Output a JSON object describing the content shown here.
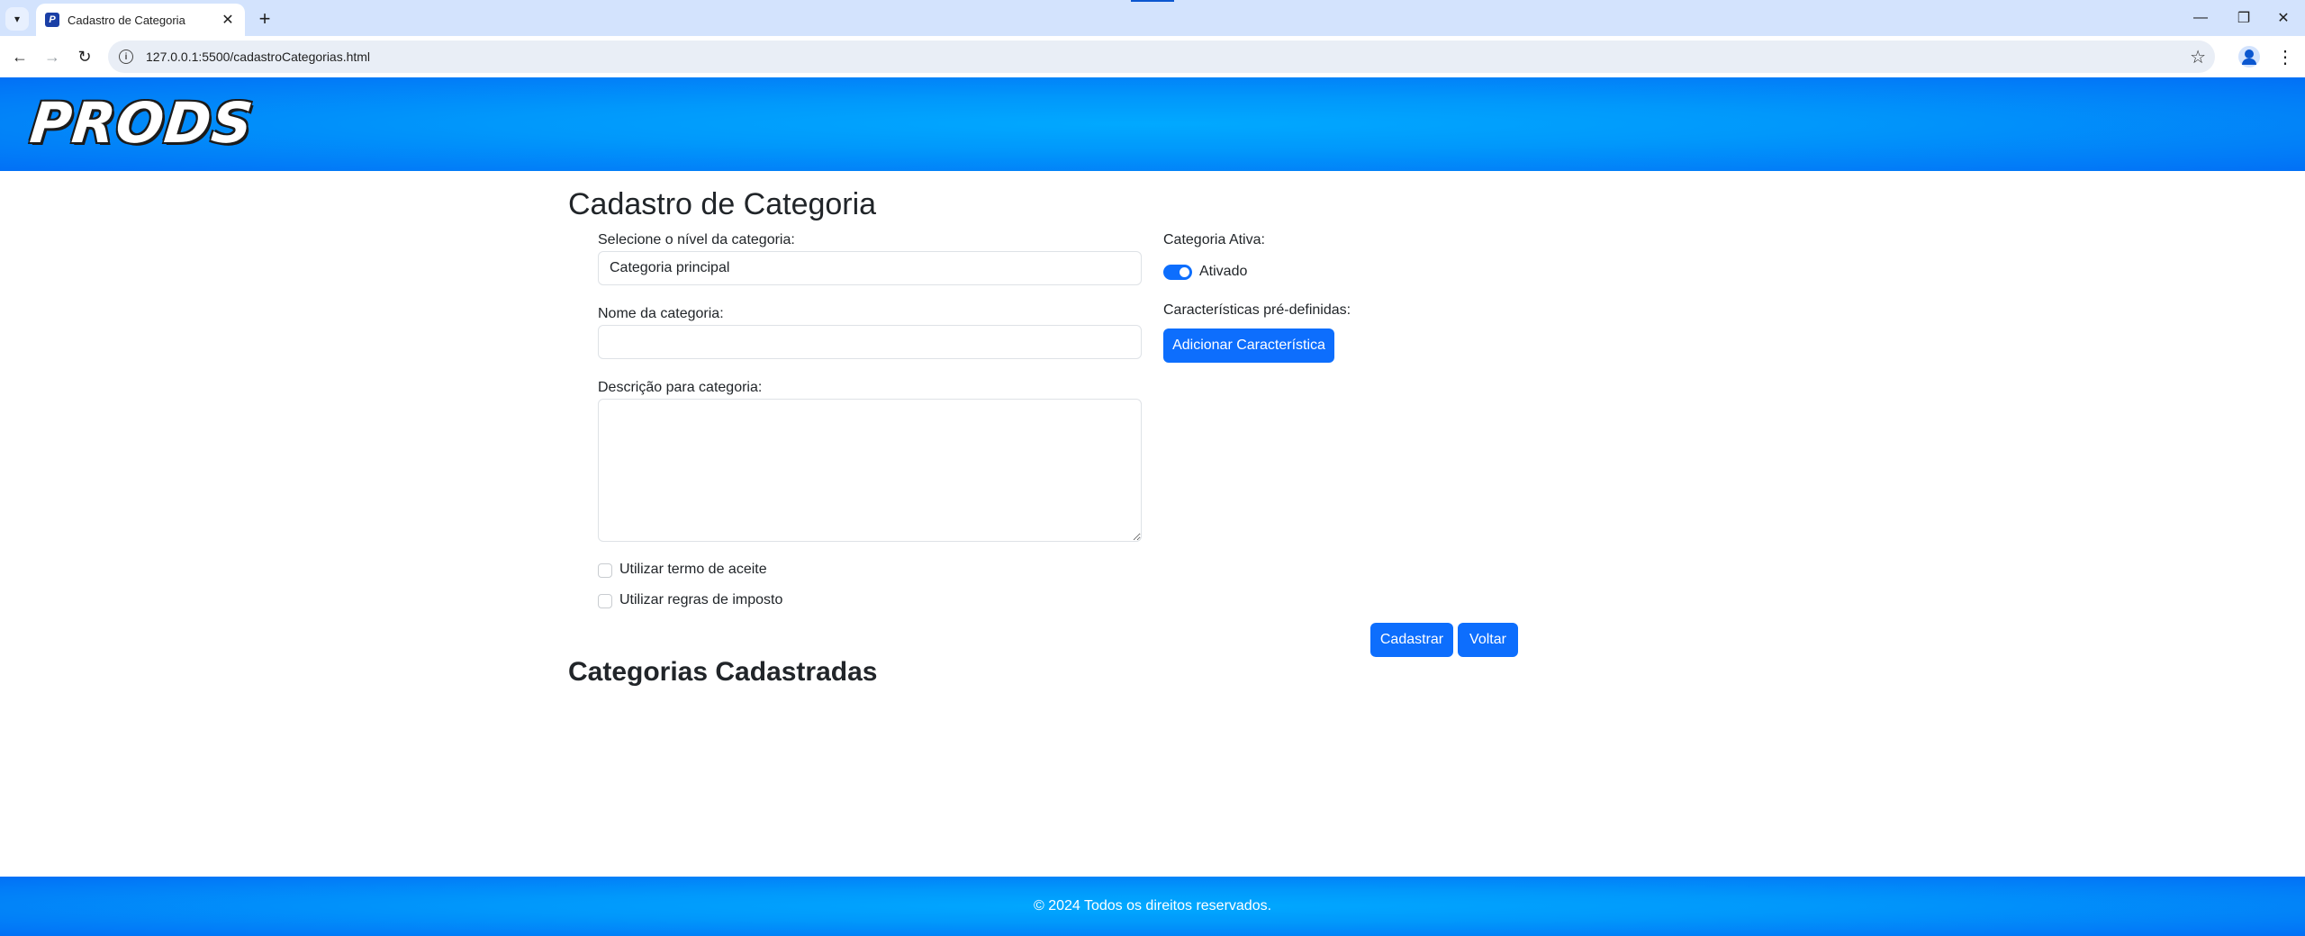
{
  "browser": {
    "tab_title": "Cadastro de Categoria",
    "favicon_letter": "P",
    "url": "127.0.0.1:5500/cadastroCategorias.html",
    "icons": {
      "tab_menu": "▾",
      "tab_close": "✕",
      "new_tab": "+",
      "back": "←",
      "forward": "→",
      "reload": "↻",
      "info": "i",
      "star": "☆",
      "kebab": "⋮",
      "minimize": "—",
      "restore": "❐",
      "close": "✕"
    }
  },
  "header": {
    "logo": "PRODS"
  },
  "form": {
    "title": "Cadastro de Categoria",
    "level_label": "Selecione o nível da categoria:",
    "level_value": "Categoria principal",
    "name_label": "Nome da categoria:",
    "name_value": "",
    "description_label": "Descrição para categoria:",
    "description_value": "",
    "terms_label": "Utilizar termo de aceite",
    "tax_label": "Utilizar regras de imposto",
    "active_label": "Categoria Ativa:",
    "active_state_label": "Ativado",
    "active_on": true,
    "features_label": "Características pré-definidas:",
    "add_feature_button": "Adicionar Característica",
    "submit_button": "Cadastrar",
    "back_button": "Voltar"
  },
  "list": {
    "title": "Categorias Cadastradas"
  },
  "footer": {
    "text": "© 2024 Todos os direitos reservados."
  },
  "colors": {
    "primary": "#0d6efd",
    "header_gradient_center": "#01a9ff",
    "header_gradient_edge": "#0270f6"
  }
}
